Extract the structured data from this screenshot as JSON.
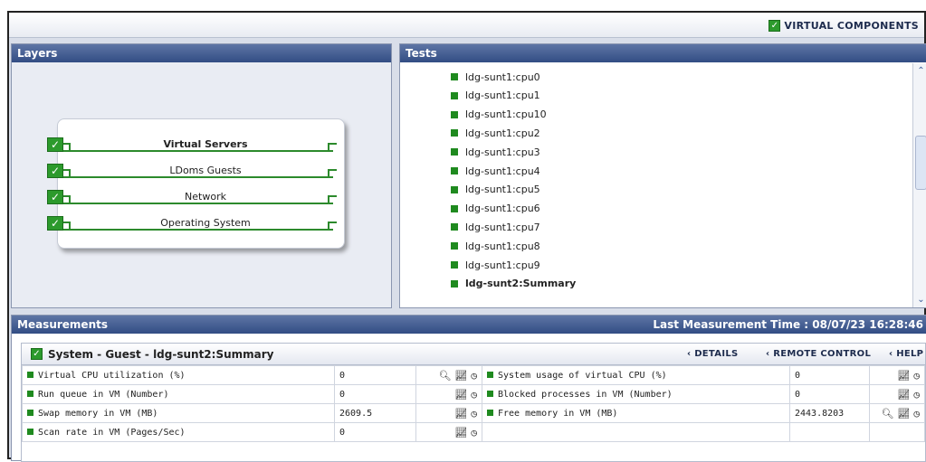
{
  "topbar": {
    "virtual_components_label": "VIRTUAL COMPONENTS"
  },
  "layers": {
    "title": "Layers",
    "items": [
      {
        "label": "Virtual Servers",
        "bold": true
      },
      {
        "label": "LDoms Guests",
        "bold": false
      },
      {
        "label": "Network",
        "bold": false
      },
      {
        "label": "Operating System",
        "bold": false
      }
    ]
  },
  "tests": {
    "title": "Tests",
    "items": [
      {
        "label": "ldg-sunt1:cpu0",
        "bold": false
      },
      {
        "label": "ldg-sunt1:cpu1",
        "bold": false
      },
      {
        "label": "ldg-sunt1:cpu10",
        "bold": false
      },
      {
        "label": "ldg-sunt1:cpu2",
        "bold": false
      },
      {
        "label": "ldg-sunt1:cpu3",
        "bold": false
      },
      {
        "label": "ldg-sunt1:cpu4",
        "bold": false
      },
      {
        "label": "ldg-sunt1:cpu5",
        "bold": false
      },
      {
        "label": "ldg-sunt1:cpu6",
        "bold": false
      },
      {
        "label": "ldg-sunt1:cpu7",
        "bold": false
      },
      {
        "label": "ldg-sunt1:cpu8",
        "bold": false
      },
      {
        "label": "ldg-sunt1:cpu9",
        "bold": false
      },
      {
        "label": "ldg-sunt2:Summary",
        "bold": true
      }
    ]
  },
  "measurements": {
    "title": "Measurements",
    "last_time": "Last Measurement Time : 08/07/23 16:28:46",
    "section_title": "System - Guest - ldg-sunt2:Summary",
    "details_label": "DETAILS",
    "remote_label": "REMOTE CONTROL",
    "help_label": "HELP",
    "rows": [
      {
        "left_name": "Virtual CPU utilization (%)",
        "left_value": "0",
        "right_name": "System usage of virtual CPU (%)",
        "right_value": "0"
      },
      {
        "left_name": "Run queue in VM (Number)",
        "left_value": "0",
        "right_name": "Blocked processes in VM (Number)",
        "right_value": "0"
      },
      {
        "left_name": "Swap memory in VM (MB)",
        "left_value": "2609.5",
        "right_name": "Free memory in VM (MB)",
        "right_value": "2443.8203"
      },
      {
        "left_name": "Scan rate in VM (Pages/Sec)",
        "left_value": "0",
        "right_name": "",
        "right_value": ""
      }
    ]
  },
  "colors": {
    "header_blue": "#324d84",
    "status_green": "#1f8a1f"
  }
}
